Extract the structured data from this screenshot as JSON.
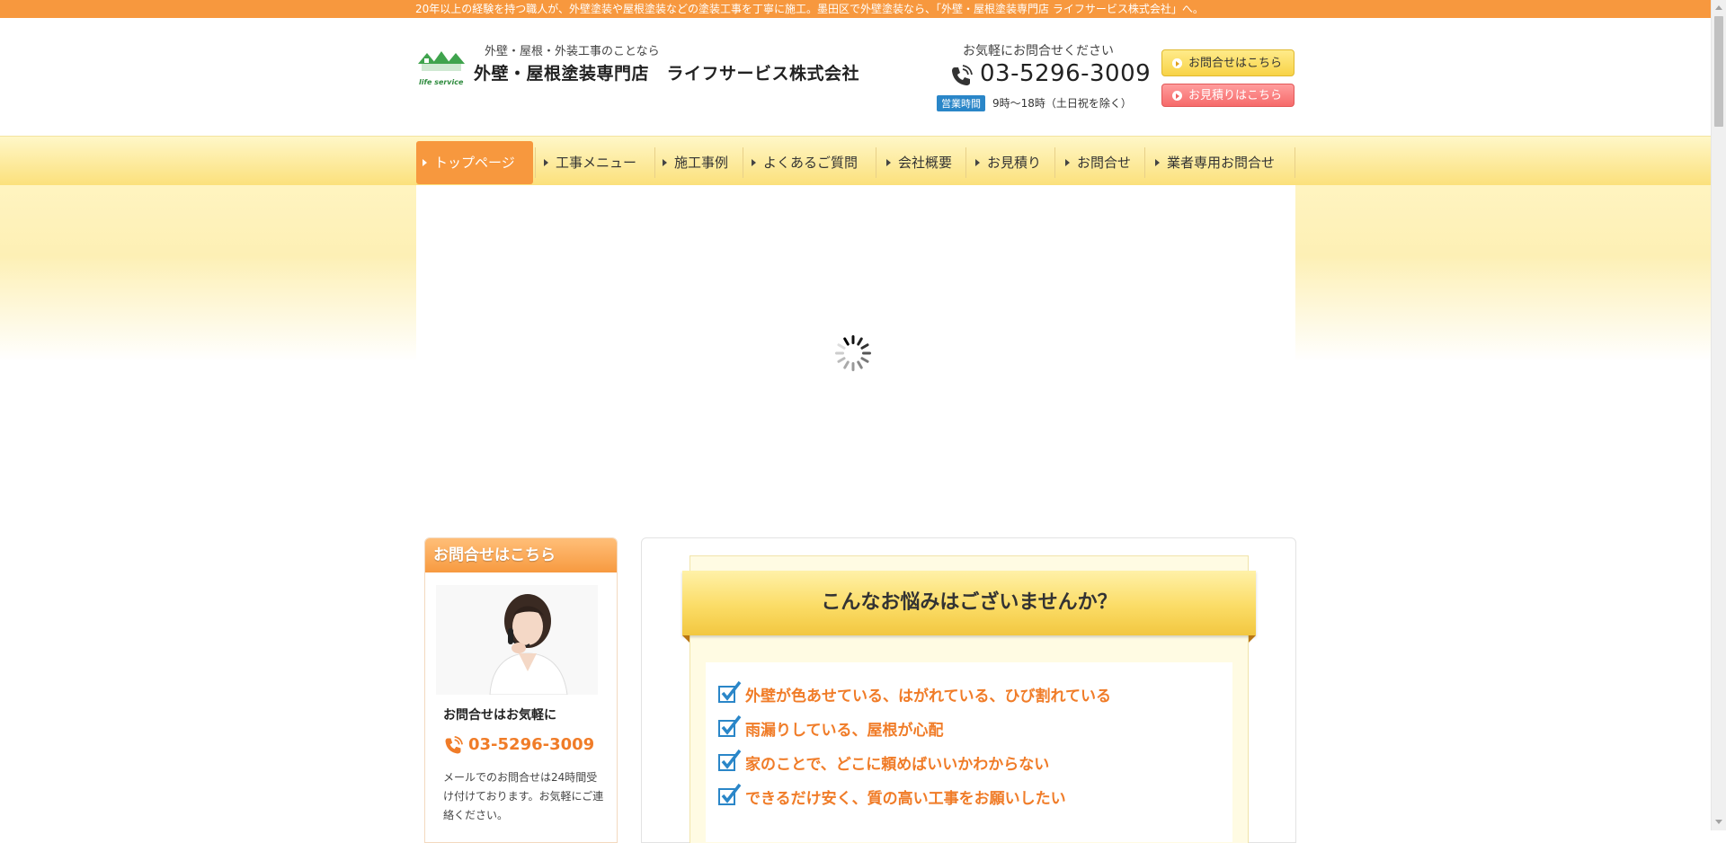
{
  "topbar": {
    "text": "20年以上の経験を持つ職人が、外壁塗装や屋根塗装などの塗装工事を丁寧に施工。墨田区で外壁塗装なら、「外壁・屋根塗装専門店 ライフサービス株式会社」へ。"
  },
  "header": {
    "logo_text": "life service",
    "tagline": "外壁・屋根・外装工事のことなら",
    "company": "外壁・屋根塗装専門店　ライフサービス株式会社",
    "tel_caption": "お気軽にお問合せください",
    "tel_number": "03-5296-3009",
    "hours_badge": "営業時間",
    "hours": "9時～18時（土日祝を除く）",
    "contact_button": "お問合せはこちら",
    "estimate_button": "お見積りはこちら",
    "icons": [
      "phone-icon",
      "play-icon"
    ]
  },
  "nav": {
    "items": [
      {
        "label": "トップページ",
        "active": true
      },
      {
        "label": "工事メニュー"
      },
      {
        "label": "施工事例"
      },
      {
        "label": "よくあるご質問"
      },
      {
        "label": "会社概要"
      },
      {
        "label": "お見積り"
      },
      {
        "label": "お問合せ"
      },
      {
        "label": "業者専用お問合せ"
      }
    ]
  },
  "hero": {
    "state": "loading",
    "icon": "loading-spinner-icon"
  },
  "sidebar": {
    "heading": "お問合せはこちら",
    "title": "お問合せはお気軽に",
    "tel": "03-5296-3009",
    "note": "メールでのお問合せは24時間受け付けております。お気軽にご連絡ください。"
  },
  "main": {
    "ribbon_title": "こんなお悩みはございませんか？",
    "checklist": [
      "外壁が色あせている、はがれている、ひび割れている",
      "雨漏りしている、屋根が心配",
      "家のことで、どこに頼めばいいかわからない",
      "できるだけ安く、質の高い工事をお願いしたい"
    ]
  },
  "colors": {
    "accent_orange": "#f7983e",
    "nav_yellow": "#fbe07a",
    "link_blue": "#2a86c8",
    "check_text": "#f07c28"
  }
}
